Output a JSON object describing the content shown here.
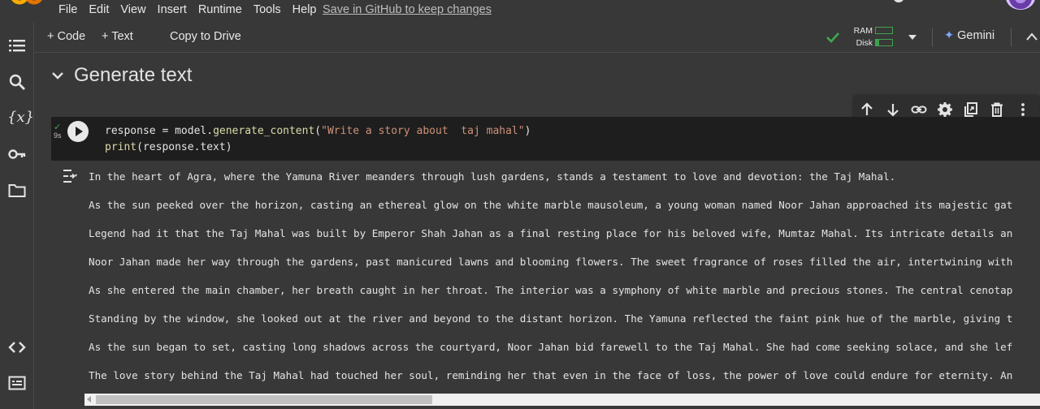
{
  "menubar": {
    "items": [
      "File",
      "Edit",
      "View",
      "Insert",
      "Runtime",
      "Tools",
      "Help"
    ],
    "save_link": "Save in GitHub to keep changes"
  },
  "toolbar": {
    "add_code": "+ Code",
    "add_text": "+ Text",
    "copy_to_drive": "Copy to Drive",
    "ram_label": "RAM",
    "disk_label": "Disk",
    "ram_level": 0.0,
    "disk_level": 0.2,
    "gemini": "Gemini",
    "connected_color": "#41a853"
  },
  "sidebar": {
    "icons": [
      "table-of-contents-icon",
      "search-icon",
      "variables-icon",
      "secrets-key-icon",
      "files-folder-icon",
      "code-snippets-icon",
      "command-palette-icon"
    ],
    "variables_glyph": "{x}"
  },
  "section": {
    "title": "Generate text"
  },
  "cell": {
    "exec_time": "9s",
    "code_lines": [
      "response = model.generate_content(\"Write a story about  taj mahal\")",
      "print(response.text)"
    ],
    "toolbar_icons": [
      "move-up-icon",
      "move-down-icon",
      "link-icon",
      "settings-icon",
      "mirror-cell-icon",
      "delete-icon",
      "more-vert-icon"
    ]
  },
  "output": {
    "lines": [
      "In the heart of Agra, where the Yamuna River meanders through lush gardens, stands a testament to love and devotion: the Taj Mahal.",
      "As the sun peeked over the horizon, casting an ethereal glow on the white marble mausoleum, a young woman named Noor Jahan approached its majestic gat",
      "Legend had it that the Taj Mahal was built by Emperor Shah Jahan as a final resting place for his beloved wife, Mumtaz Mahal. Its intricate details an",
      "Noor Jahan made her way through the gardens, past manicured lawns and blooming flowers. The sweet fragrance of roses filled the air, intertwining with",
      "As she entered the main chamber, her breath caught in her throat. The interior was a symphony of white marble and precious stones. The central cenotap",
      "Standing by the window, she looked out at the river and beyond to the distant horizon. The Yamuna reflected the faint pink hue of the marble, giving t",
      "As the sun began to set, casting long shadows across the courtyard, Noor Jahan bid farewell to the Taj Mahal. She had come seeking solace, and she lef",
      "The love story behind the Taj Mahal had touched her soul, reminding her that even in the face of loss, the power of love could endure for eternity. An"
    ]
  }
}
